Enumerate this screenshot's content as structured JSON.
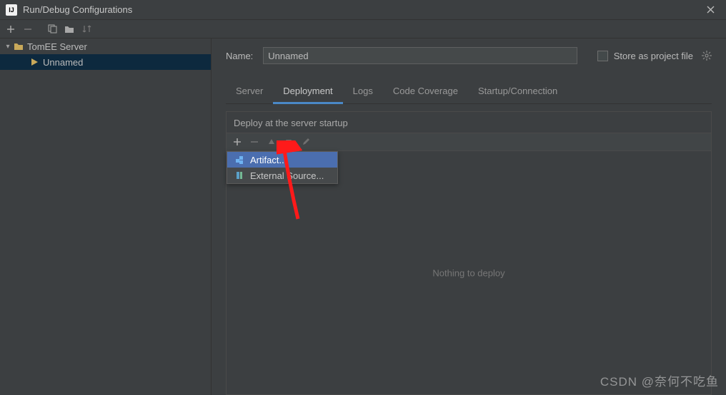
{
  "window": {
    "title": "Run/Debug Configurations",
    "app_icon_text": "IJ"
  },
  "sidebar": {
    "nodes": [
      {
        "label": "TomEE Server",
        "expanded": true
      },
      {
        "label": "Unnamed",
        "selected": true
      }
    ]
  },
  "form": {
    "name_label": "Name:",
    "name_value": "Unnamed",
    "store_label": "Store as project file"
  },
  "tabs": [
    {
      "key": "server",
      "label": "Server"
    },
    {
      "key": "deployment",
      "label": "Deployment",
      "active": true
    },
    {
      "key": "logs",
      "label": "Logs"
    },
    {
      "key": "coverage",
      "label": "Code Coverage"
    },
    {
      "key": "startup",
      "label": "Startup/Connection"
    }
  ],
  "deploy_panel": {
    "header": "Deploy at the server startup",
    "empty_message": "Nothing to deploy"
  },
  "popup": {
    "items": [
      {
        "label": "Artifact...",
        "highlight": true
      },
      {
        "label": "External Source...",
        "highlight": false
      }
    ]
  },
  "watermark": "CSDN @奈何不吃鱼"
}
